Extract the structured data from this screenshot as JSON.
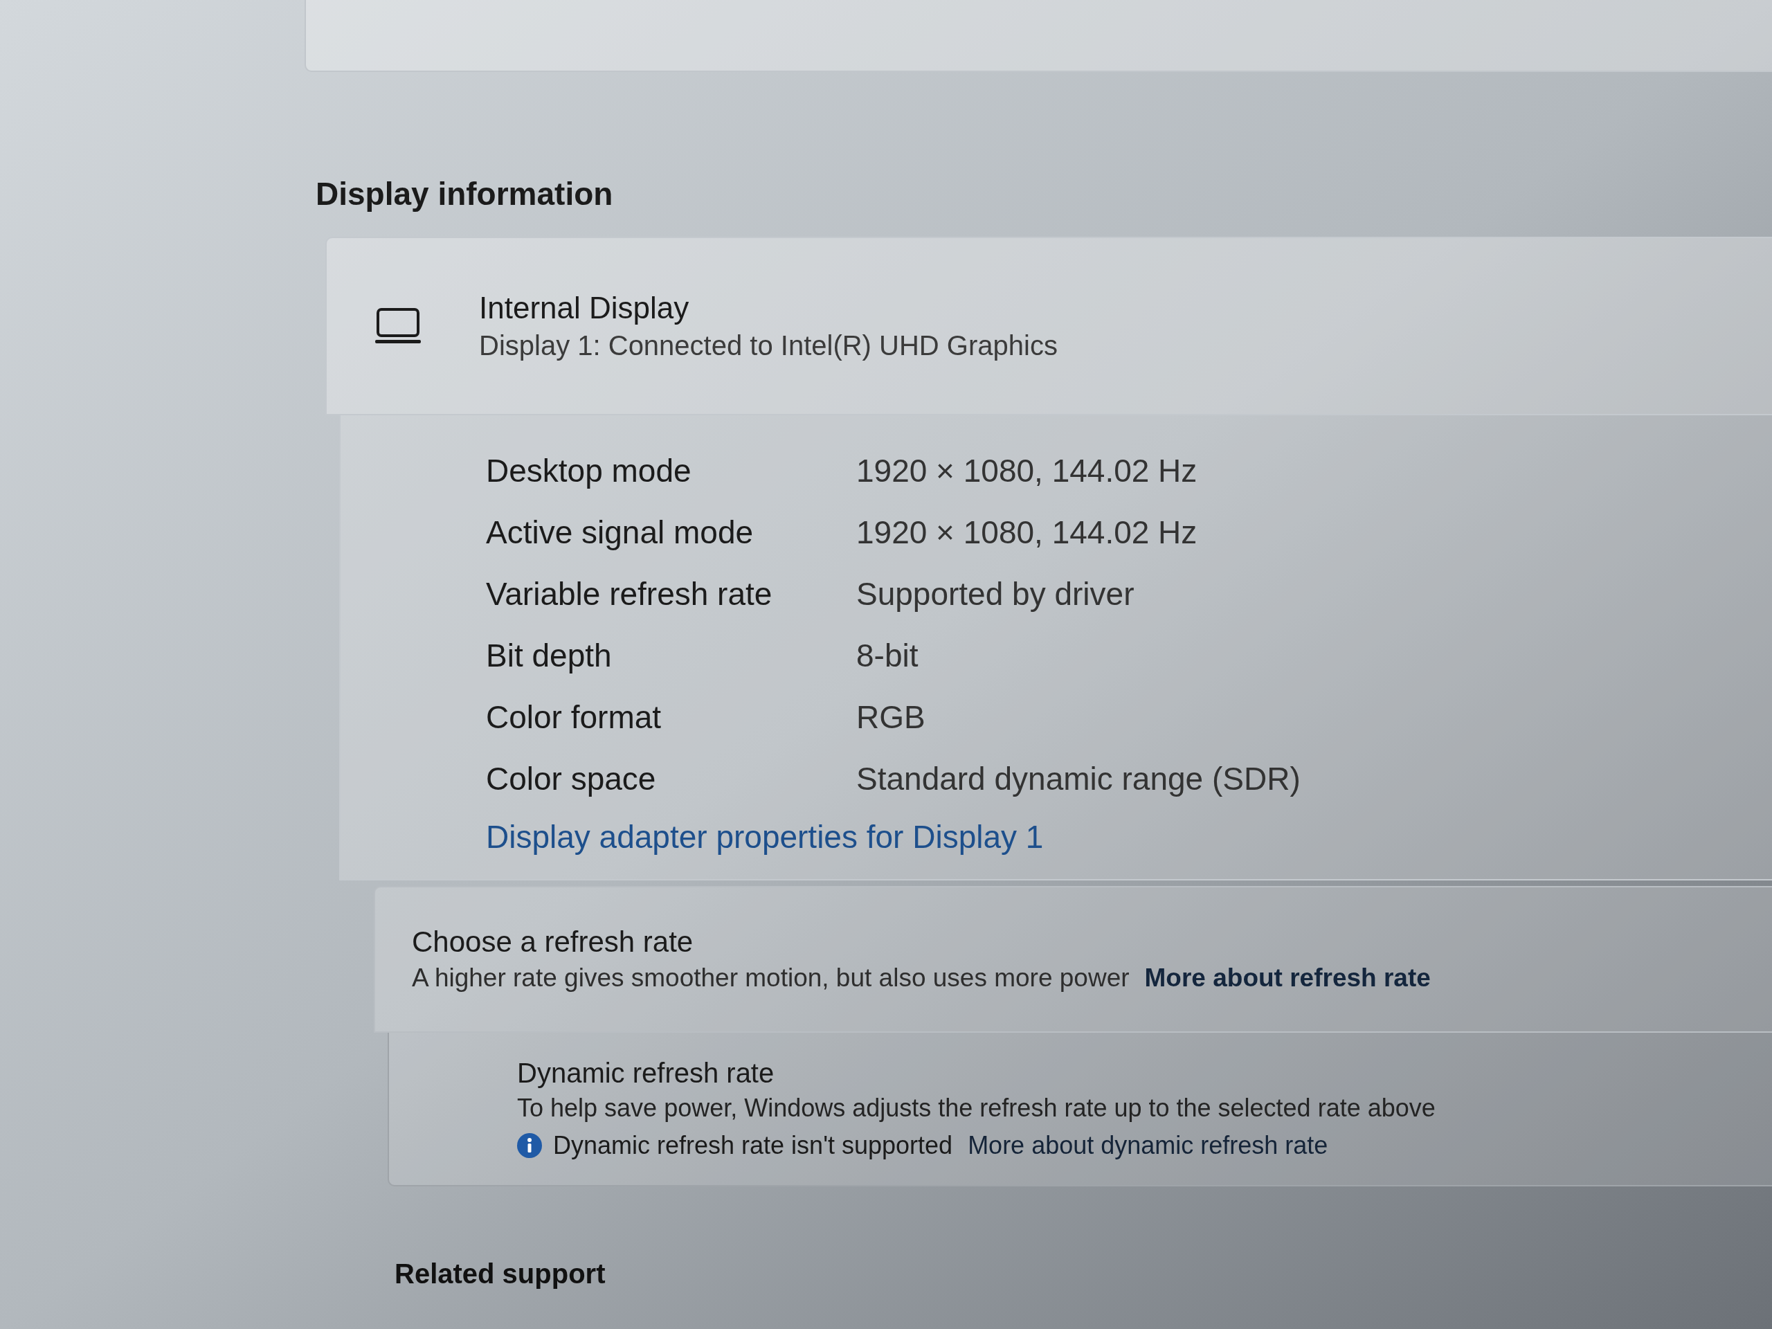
{
  "section_title": "Display information",
  "display": {
    "name": "Internal Display",
    "subtitle": "Display 1: Connected to Intel(R) UHD Graphics"
  },
  "properties": [
    {
      "label": "Desktop mode",
      "value": "1920 × 1080, 144.02 Hz"
    },
    {
      "label": "Active signal mode",
      "value": "1920 × 1080, 144.02 Hz"
    },
    {
      "label": "Variable refresh rate",
      "value": "Supported by driver"
    },
    {
      "label": "Bit depth",
      "value": "8-bit"
    },
    {
      "label": "Color format",
      "value": "RGB"
    },
    {
      "label": "Color space",
      "value": "Standard dynamic range (SDR)"
    }
  ],
  "adapter_link": "Display adapter properties for Display 1",
  "refresh_rate": {
    "title": "Choose a refresh rate",
    "description": "A higher rate gives smoother motion, but also uses more power",
    "link": "More about refresh rate"
  },
  "dynamic_refresh": {
    "title": "Dynamic refresh rate",
    "description": "To help save power, Windows adjusts the refresh rate up to the selected rate above",
    "notice": "Dynamic refresh rate isn't supported",
    "link": "More about dynamic refresh rate"
  },
  "related_heading": "Related support"
}
